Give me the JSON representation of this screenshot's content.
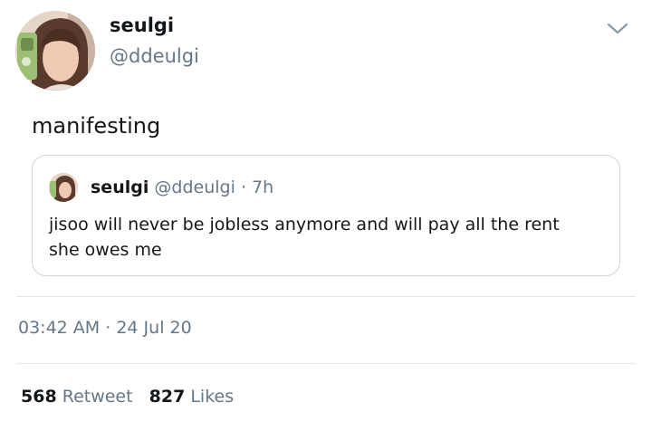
{
  "tweet": {
    "author": {
      "name": "seulgi",
      "handle": "@ddeulgi"
    },
    "text": "manifesting",
    "timestamp": "03:42 AM",
    "dot": "·",
    "date": "24 Jul 20",
    "stats": {
      "retweets": {
        "count": "568",
        "label": "Retweet"
      },
      "likes": {
        "count": "827",
        "label": "Likes"
      }
    },
    "menu_icon": "chevron-down-icon"
  },
  "quoted": {
    "author": {
      "name": "seulgi",
      "handle": "@ddeulgi"
    },
    "dot": "·",
    "time": "7h",
    "text": "jisoo will never be jobless anymore and will pay all the rent she owes me"
  },
  "colors": {
    "primary_text": "#14171a",
    "secondary_text": "#657786",
    "border": "#ccd6dd",
    "divider": "#e1e8ed"
  }
}
